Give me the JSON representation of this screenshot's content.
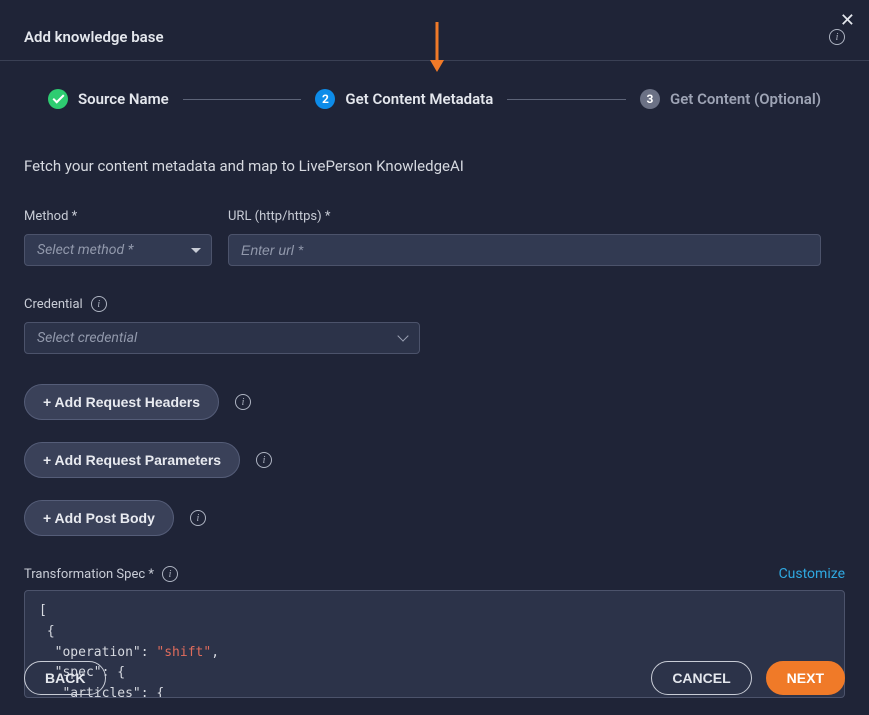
{
  "header": {
    "title": "Add knowledge base"
  },
  "stepper": {
    "step1": {
      "label": "Source Name"
    },
    "step2": {
      "num": "2",
      "label": "Get Content Metadata"
    },
    "step3": {
      "num": "3",
      "label": "Get Content (Optional)"
    }
  },
  "subtitle": "Fetch your content metadata and map to LivePerson KnowledgeAI",
  "method": {
    "label": "Method *",
    "placeholder": "Select method *"
  },
  "url": {
    "label": "URL (http/https) *",
    "placeholder": "Enter url *"
  },
  "credential": {
    "label": "Credential",
    "placeholder": "Select credential"
  },
  "buttons": {
    "add_headers": "+ Add Request Headers",
    "add_params": "+ Add Request Parameters",
    "add_body": "+ Add Post Body"
  },
  "spec": {
    "label": "Transformation Spec *",
    "customize": "Customize",
    "code_pre": "[\n {\n  \"operation\": ",
    "code_str": "\"shift\"",
    "code_post": ",\n  \"spec\": {\n   \"articles\": {"
  },
  "footer": {
    "back": "BACK",
    "cancel": "CANCEL",
    "next": "NEXT"
  }
}
